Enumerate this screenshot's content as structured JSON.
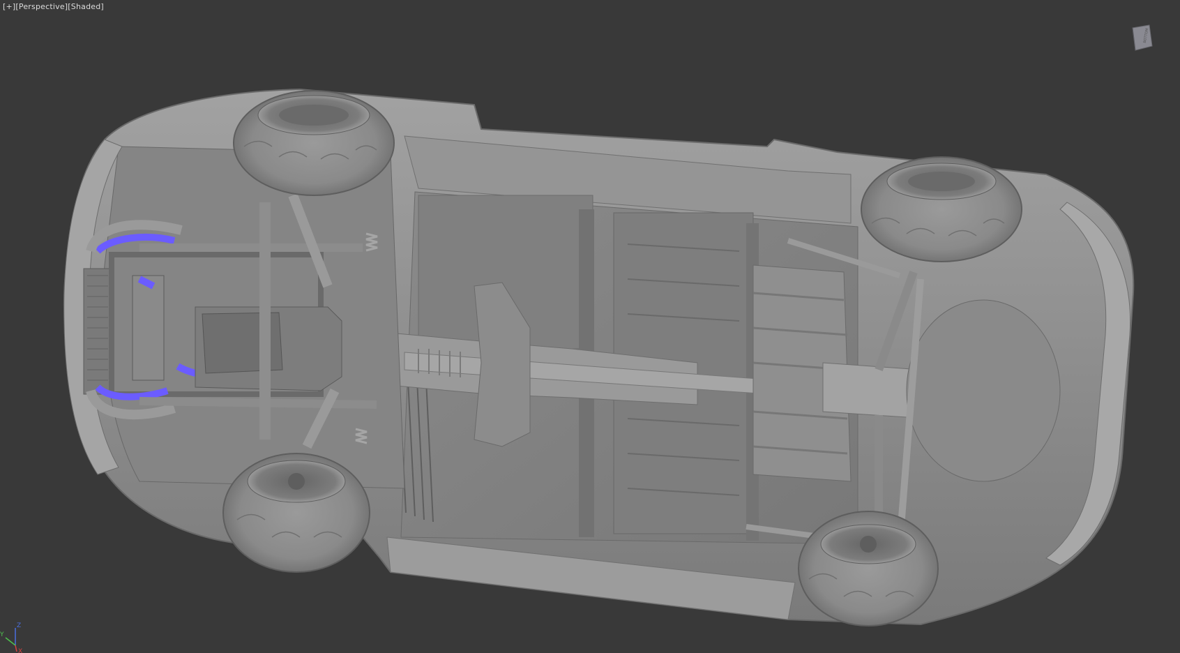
{
  "viewport": {
    "label_plus": "[+]",
    "label_view": "[Perspective]",
    "label_shading": "[Shaded]",
    "viewcube_face": "BOTTOM"
  },
  "axes": {
    "x": "X",
    "y": "Y",
    "z": "Z"
  },
  "model": {
    "name": "car-underbody",
    "accent_color": "#6b5cff",
    "body_color": "#8e8e8e"
  },
  "colors": {
    "background": "#393939",
    "axis_x": "#d94040",
    "axis_y": "#4ec14e",
    "axis_z": "#4a6fe0"
  }
}
